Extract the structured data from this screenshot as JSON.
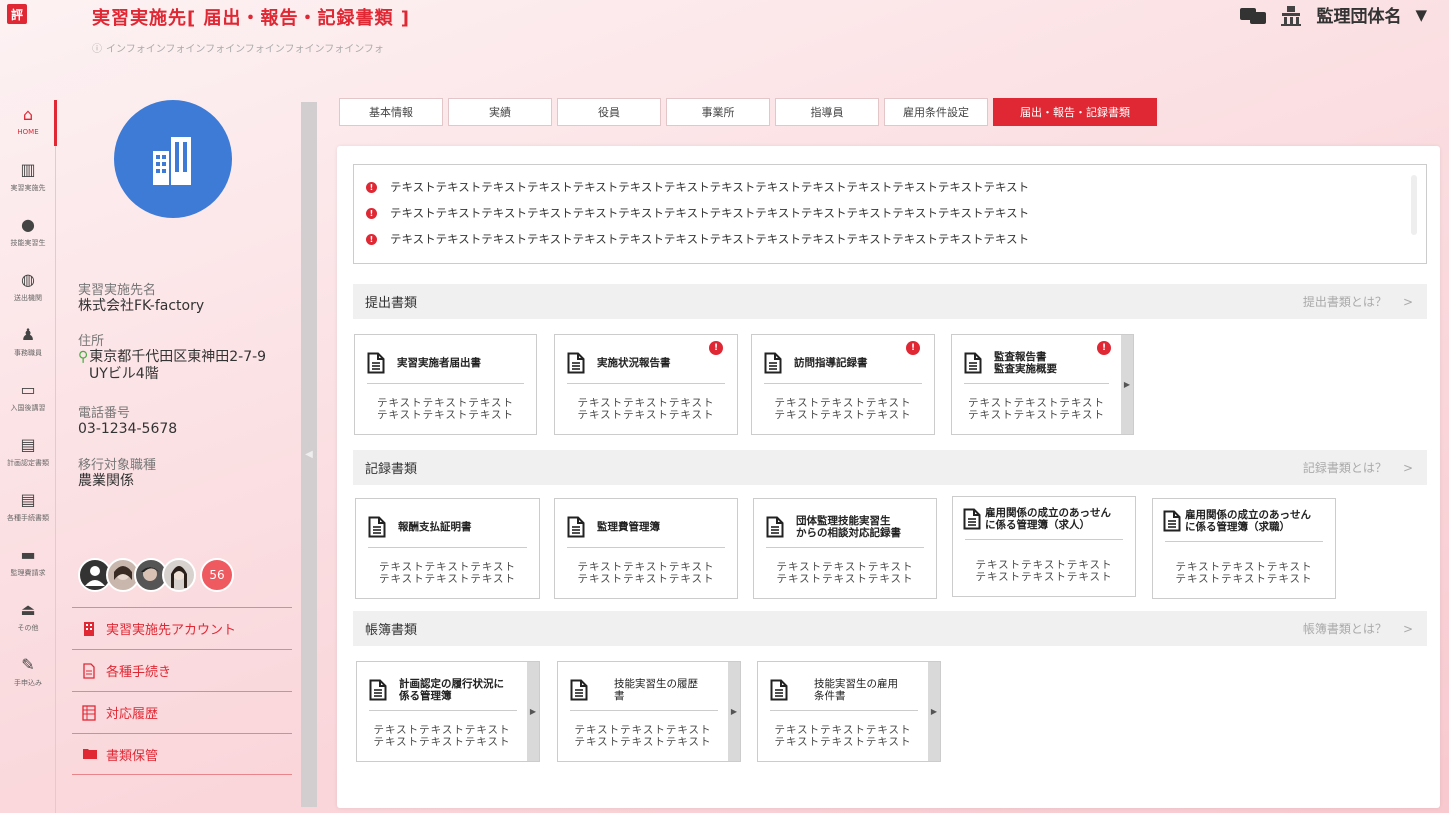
{
  "header": {
    "logo_text": "評",
    "title": "実習実施先[ 届出・報告・記録書類 ]",
    "subtitle": "インフォインフォインフォインフォインフォインフォインフォ",
    "org_name": "監理団体名",
    "caret": "▼"
  },
  "nav": {
    "items": [
      {
        "label": "HOME",
        "icon": "home-icon"
      },
      {
        "label": "実習実施先",
        "icon": "building-icon"
      },
      {
        "label": "技能実習生",
        "icon": "person-icon"
      },
      {
        "label": "送出機関",
        "icon": "globe-icon"
      },
      {
        "label": "事務職員",
        "icon": "staff-icon"
      },
      {
        "label": "入国後講習",
        "icon": "monitor-icon"
      },
      {
        "label": "計画認定書類",
        "icon": "document-icon"
      },
      {
        "label": "各種手続書類",
        "icon": "document-icon"
      },
      {
        "label": "監理費請求",
        "icon": "printer-icon"
      },
      {
        "label": "その他",
        "icon": "eject-icon"
      },
      {
        "label": "手申込み",
        "icon": "signature-icon"
      }
    ]
  },
  "profile": {
    "name_label": "実習実施先名",
    "name_value": "株式会社FK-factory",
    "address_label": "住所",
    "address_line1": "東京都千代田区東神田2-7-9",
    "address_line2": "UYビル4階",
    "phone_label": "電話番号",
    "phone_value": "03-1234-5678",
    "job_label": "移行対象職種",
    "job_value": "農業関係",
    "member_count": "56",
    "menu": [
      {
        "label": "実習実施先アカウント",
        "icon": "building-small-icon"
      },
      {
        "label": "各種手続き",
        "icon": "file-icon"
      },
      {
        "label": "対応履歴",
        "icon": "table-icon"
      },
      {
        "label": "書類保管",
        "icon": "folder-icon"
      }
    ]
  },
  "collapse_arrow": "◀",
  "tabs": [
    "基本情報",
    "実績",
    "役員",
    "事業所",
    "指導員",
    "雇用条件設定",
    "届出・報告・記録書類"
  ],
  "alerts": [
    "テキストテキストテキストテキストテキストテキストテキストテキストテキストテキストテキストテキストテキストテキスト",
    "テキストテキストテキストテキストテキストテキストテキストテキストテキストテキストテキストテキストテキストテキスト",
    "テキストテキストテキストテキストテキストテキストテキストテキストテキストテキストテキストテキストテキストテキスト"
  ],
  "sections": [
    {
      "title": "提出書類",
      "link": "提出書類とは？",
      "cards": [
        {
          "title": "実習実施者届出書",
          "desc1": "テキストテキストテキスト",
          "desc2": "テキストテキストテキスト",
          "alert": false
        },
        {
          "title": "実施状況報告書",
          "desc1": "テキストテキストテキスト",
          "desc2": "テキストテキストテキスト",
          "alert": true
        },
        {
          "title": "訪問指導記録書",
          "desc1": "テキストテキストテキスト",
          "desc2": "テキストテキストテキスト",
          "alert": true
        },
        {
          "title": "監査報告書\n監査実施概要",
          "desc1": "テキストテキストテキスト",
          "desc2": "テキストテキストテキスト",
          "alert": true
        }
      ]
    },
    {
      "title": "記録書類",
      "link": "記録書類とは？",
      "cards": [
        {
          "title": "報酬支払証明書",
          "desc1": "テキストテキストテキスト",
          "desc2": "テキストテキストテキスト"
        },
        {
          "title": "監理費管理簿",
          "desc1": "テキストテキストテキスト",
          "desc2": "テキストテキストテキスト"
        },
        {
          "title": "団体監理技能実習生\nからの相談対応記録書",
          "desc1": "テキストテキストテキスト",
          "desc2": "テキストテキストテキスト"
        },
        {
          "title": "雇用関係の成立のあっせん\nに係る管理簿（求人）",
          "desc1": "テキストテキストテキスト",
          "desc2": "テキストテキストテキスト"
        },
        {
          "title": "雇用関係の成立のあっせん\nに係る管理簿（求職）",
          "desc1": "テキストテキストテキスト",
          "desc2": "テキストテキストテキスト"
        }
      ]
    },
    {
      "title": "帳簿書類",
      "link": "帳簿書類とは？",
      "cards": [
        {
          "title": "計画認定の履行状況に\n係る管理簿",
          "desc1": "テキストテキストテキスト",
          "desc2": "テキストテキストテキスト"
        },
        {
          "title": "技能実習生の履歴\n書",
          "desc1": "テキストテキストテキスト",
          "desc2": "テキストテキストテキスト"
        },
        {
          "title": "技能実習生の雇用\n条件書",
          "desc1": "テキストテキストテキスト",
          "desc2": "テキストテキストテキスト"
        }
      ]
    }
  ],
  "chevron": ">",
  "alert_mark": "!",
  "card_arrow": "▶",
  "colors": {
    "accent": "#e02834",
    "avatar_bg": "#3d7bd6",
    "pin": "#4caa44"
  }
}
